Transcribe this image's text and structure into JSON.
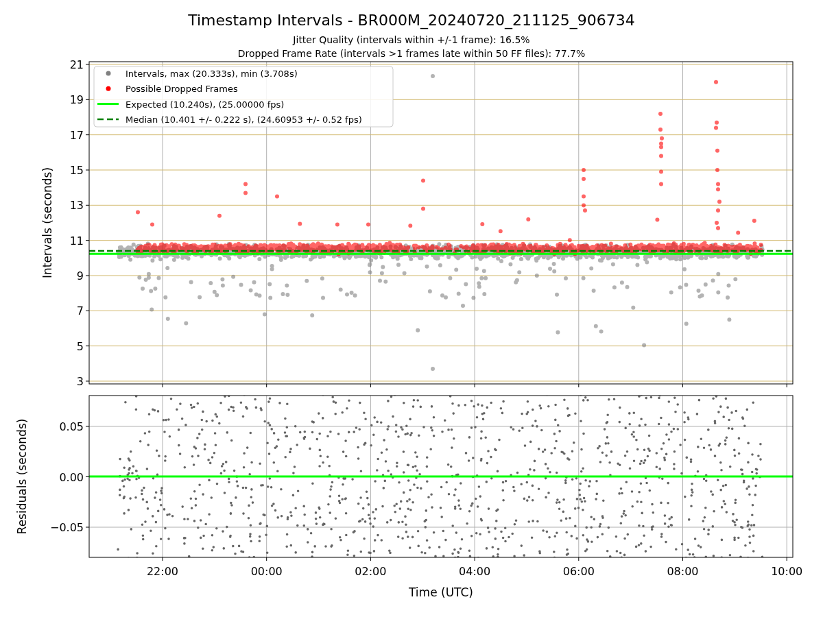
{
  "title": "Timestamp Intervals - BR000M_20240720_211125_906734",
  "subtitles": [
    "Jitter Quality (intervals within +/-1 frame): 16.5%",
    "Dropped Frame Rate (intervals >1 frames late within 50 FF files): 77.7%"
  ],
  "intervals_plot": {
    "ylabel": "Intervals (seconds)",
    "yticks": [
      "21",
      "19",
      "17",
      "15",
      "13",
      "11",
      "9",
      "7",
      "5",
      "3"
    ],
    "legend": [
      {
        "kind": "dots",
        "color": "#808080",
        "label": "Intervals, max (20.333s), min (3.708s)"
      },
      {
        "kind": "dots",
        "color": "#ff0000",
        "label": "Possible Dropped Frames"
      },
      {
        "kind": "line",
        "color": "#00ff00",
        "label": "Expected (10.240s), (25.00000 fps)"
      },
      {
        "kind": "dashed",
        "color": "#008000",
        "label": "Median (10.401 +/- 0.222 s), (24.60953 +/- 0.52 fps)"
      }
    ]
  },
  "residuals_plot": {
    "ylabel": "Residuals (seconds)",
    "yticks": [
      "0.05",
      "0.00",
      "−0.05"
    ]
  },
  "xaxis": {
    "label": "Time (UTC)",
    "ticks": [
      "22:00",
      "00:00",
      "02:00",
      "04:00",
      "06:00",
      "08:00",
      "10:00"
    ]
  }
}
